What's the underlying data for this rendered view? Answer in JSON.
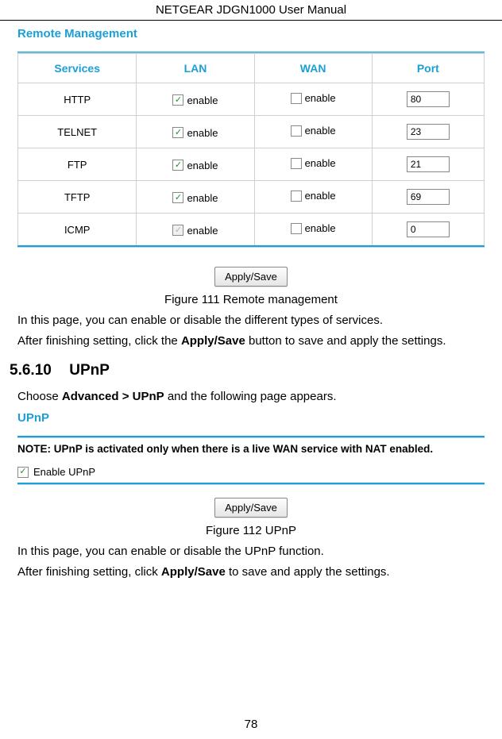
{
  "header": {
    "title": "NETGEAR JDGN1000 User Manual"
  },
  "remote": {
    "title": "Remote Management",
    "columns": {
      "services": "Services",
      "lan": "LAN",
      "wan": "WAN",
      "port": "Port"
    },
    "enable_label": "enable",
    "rows": [
      {
        "service": "HTTP",
        "lan_checked": true,
        "lan_disabled": false,
        "wan_checked": false,
        "port": "80"
      },
      {
        "service": "TELNET",
        "lan_checked": true,
        "lan_disabled": false,
        "wan_checked": false,
        "port": "23"
      },
      {
        "service": "FTP",
        "lan_checked": true,
        "lan_disabled": false,
        "wan_checked": false,
        "port": "21"
      },
      {
        "service": "TFTP",
        "lan_checked": true,
        "lan_disabled": false,
        "wan_checked": false,
        "port": "69"
      },
      {
        "service": "ICMP",
        "lan_checked": true,
        "lan_disabled": true,
        "wan_checked": false,
        "port": "0"
      }
    ],
    "apply_label": "Apply/Save",
    "caption": "Figure 111 Remote management",
    "text1": "In this page, you can enable or disable the different types of services.",
    "text2_pre": "After finishing setting, click the ",
    "text2_bold": "Apply/Save",
    "text2_post": " button to save and apply the settings."
  },
  "upnp": {
    "heading_num": "5.6.10",
    "heading_text": "UPnP",
    "choose_pre": "Choose ",
    "choose_bold": "Advanced > UPnP",
    "choose_post": " and the following page appears.",
    "title": "UPnP",
    "note": "NOTE: UPnP is activated only when there is a live WAN service with NAT enabled.",
    "enable_checked": true,
    "enable_label": "Enable UPnP",
    "apply_label": "Apply/Save",
    "caption": "Figure 112 UPnP",
    "text1": "In this page, you can enable or disable the UPnP function.",
    "text2_pre": "After finishing setting, click ",
    "text2_bold": "Apply/Save",
    "text2_post": " to save and apply the settings."
  },
  "page_number": "78"
}
